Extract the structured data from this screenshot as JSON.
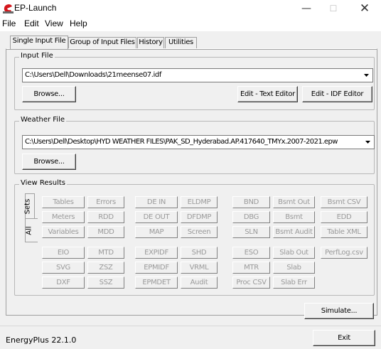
{
  "window": {
    "title": "EP-Launch"
  },
  "menu": [
    "File",
    "Edit",
    "View",
    "Help"
  ],
  "tabs": [
    "Single Input File",
    "Group of Input Files",
    "History",
    "Utilities"
  ],
  "input_file": {
    "label": "Input File",
    "path": "C:\\Users\\Dell\\Downloads\\21meense07.idf",
    "browse": "Browse...",
    "edit_text": "Edit - Text Editor",
    "edit_idf": "Edit - IDF Editor"
  },
  "weather_file": {
    "label": "Weather File",
    "path": "C:\\Users\\Dell\\Desktop\\HYD WEATHER FILES\\PAK_SD_Hyderabad.AP.417640_TMYx.2007-2021.epw",
    "browse": "Browse..."
  },
  "view_results": {
    "label": "View Results",
    "side_tabs": [
      "Sets",
      "All"
    ],
    "buttons": [
      "Tables",
      "Errors",
      "DE IN",
      "ELDMP",
      "BND",
      "Bsmt Out",
      "Bsmt CSV",
      "Meters",
      "RDD",
      "DE OUT",
      "DFDMP",
      "DBG",
      "Bsmt",
      "EDD",
      "Variables",
      "MDD",
      "MAP",
      "Screen",
      "SLN",
      "Bsmt Audit",
      "Table XML",
      "EIO",
      "MTD",
      "EXPIDF",
      "SHD",
      "ESO",
      "Slab Out",
      "PerfLog.csv",
      "SVG",
      "ZSZ",
      "EPMIDF",
      "VRML",
      "MTR",
      "Slab",
      "DXF",
      "SSZ",
      "EPMDET",
      "Audit",
      "Proc CSV",
      "Slab Err"
    ]
  },
  "simulate": "Simulate...",
  "status": "EnergyPlus 22.1.0",
  "exit": "Exit"
}
